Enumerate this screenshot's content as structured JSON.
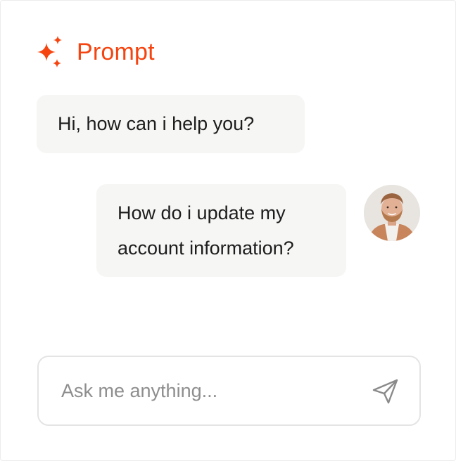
{
  "header": {
    "title": "Prompt",
    "icon": "sparkle-icon"
  },
  "messages": [
    {
      "role": "assistant",
      "lines": [
        "Hi, how can i help you?"
      ]
    },
    {
      "role": "user",
      "lines": [
        "How do i update my",
        "account information?"
      ],
      "avatar": "user-avatar"
    }
  ],
  "composer": {
    "placeholder": "Ask me anything...",
    "value": "",
    "send_icon": "send-icon"
  },
  "colors": {
    "accent": "#f5440f",
    "bubble_bg": "#f6f6f5",
    "text": "#1d1d1d",
    "placeholder": "#8e8e8e",
    "border": "#e4e4e4"
  }
}
